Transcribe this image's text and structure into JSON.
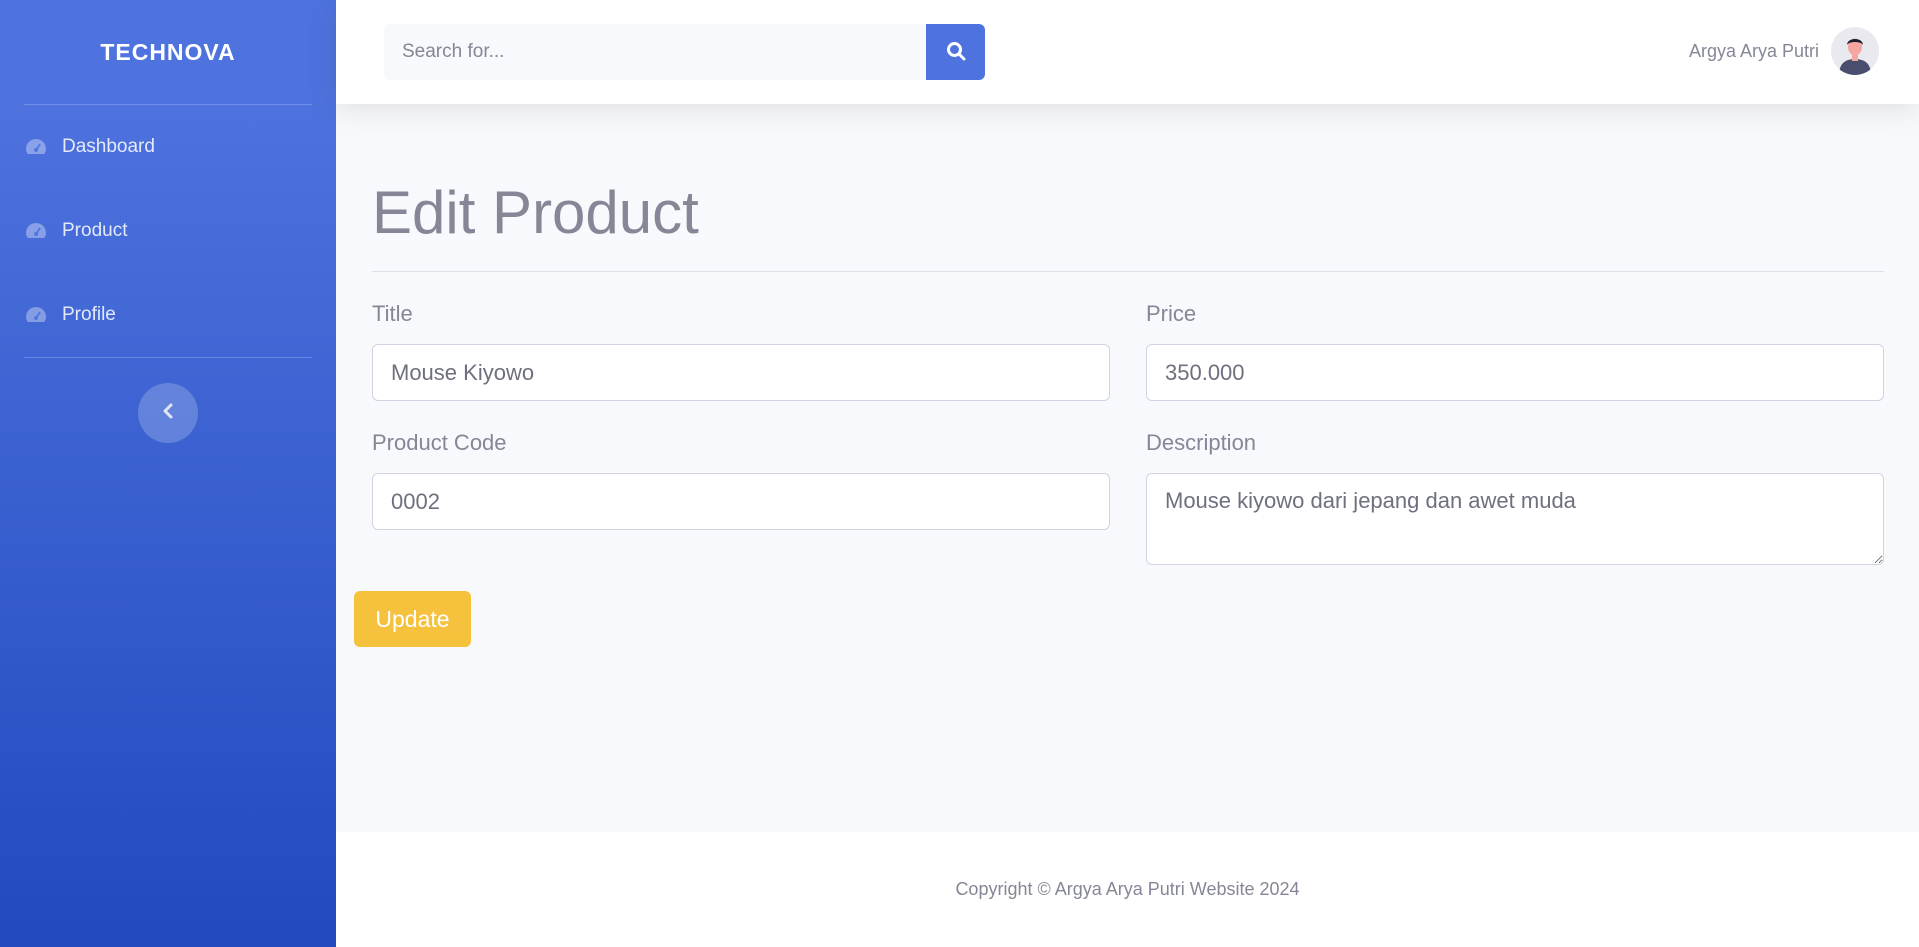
{
  "brand": {
    "name": "TECHNOVA"
  },
  "sidebar": {
    "items": [
      {
        "label": "Dashboard",
        "icon": "tachometer-icon"
      },
      {
        "label": "Product",
        "icon": "tachometer-icon"
      },
      {
        "label": "Profile",
        "icon": "tachometer-icon"
      }
    ],
    "toggle_icon": "chevron-left-icon"
  },
  "topbar": {
    "search_placeholder": "Search for...",
    "search_icon": "search-icon",
    "user_name": "Argya Arya Putri"
  },
  "page": {
    "title": "Edit Product"
  },
  "form": {
    "title_label": "Title",
    "title_value": "Mouse Kiyowo",
    "price_label": "Price",
    "price_value": "350.000",
    "code_label": "Product Code",
    "code_value": "0002",
    "description_label": "Description",
    "description_value": "Mouse kiyowo dari jepang dan awet muda",
    "submit_label": "Update"
  },
  "footer": {
    "text": "Copyright © Argya Arya Putri Website 2024"
  },
  "colors": {
    "primary": "#4e73df",
    "warning": "#f6c23e",
    "text_muted": "#858796",
    "background": "#f8f9fc"
  }
}
